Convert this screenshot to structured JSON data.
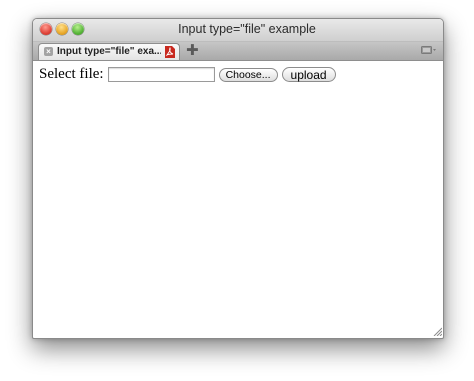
{
  "window": {
    "title": "Input type=\"file\" example"
  },
  "tabs": [
    {
      "label": "Input type=\"file\" exa...",
      "favicon": "pdf-favicon-icon",
      "close_glyph": "×"
    }
  ],
  "tabbar": {
    "new_tab_glyph": "✚",
    "new_tab_icon": "plus-icon",
    "tab_view_icon": "tab-overview-icon"
  },
  "form": {
    "label": "Select file:",
    "file_value": "",
    "choose_label": "Choose...",
    "upload_label": "upload"
  },
  "colors": {
    "close_light": "#e0443a",
    "minimize_light": "#e9a92b",
    "zoom_light": "#58b63a",
    "favicon_red": "#c8281e"
  }
}
